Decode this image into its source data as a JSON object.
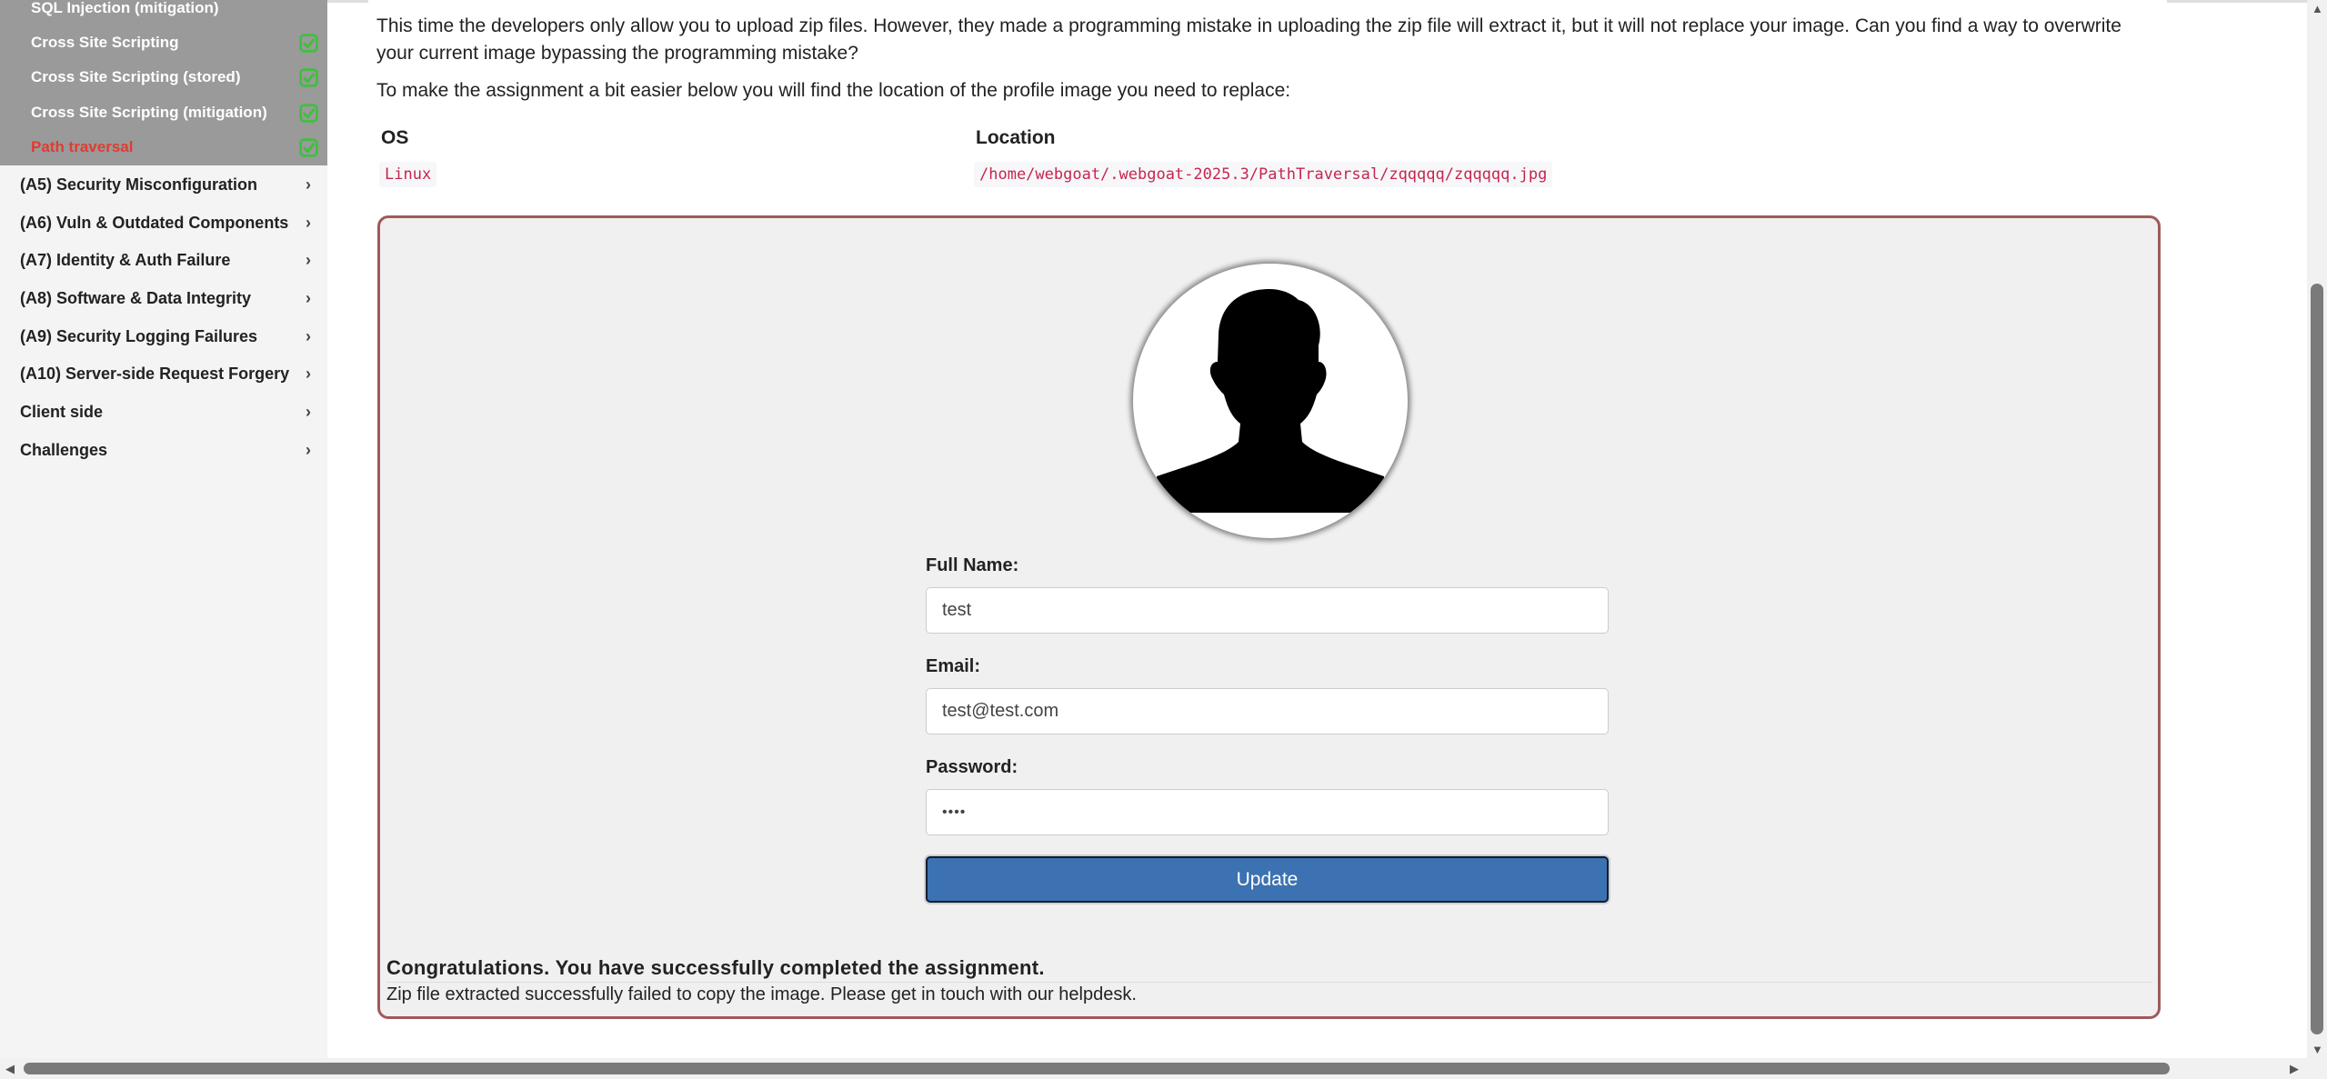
{
  "sidebar": {
    "subitems": [
      {
        "label": "SQL Injection (mitigation)",
        "done": true
      },
      {
        "label": "Cross Site Scripting",
        "done": true
      },
      {
        "label": "Cross Site Scripting (stored)",
        "done": true
      },
      {
        "label": "Cross Site Scripting (mitigation)",
        "done": true
      },
      {
        "label": "Path traversal",
        "done": true,
        "active": true
      }
    ],
    "categories": [
      "(A5) Security Misconfiguration",
      "(A6) Vuln & Outdated Components",
      "(A7) Identity & Auth Failure",
      "(A8) Software & Data Integrity",
      "(A9) Security Logging Failures",
      "(A10) Server-side Request Forgery",
      "Client side",
      "Challenges"
    ],
    "chevron": "›",
    "check_icon": "check-square-icon",
    "colors": {
      "check": "#3fbf3f",
      "active": "#e03c31",
      "submenu_bg": "#9a9a9a"
    }
  },
  "lesson": {
    "intro": "This time the developers only allow you to upload zip files. However, they made a programming mistake in uploading the zip file will extract it, but it will not replace your image. Can you find a way to overwrite your current image bypassing the programming mistake?",
    "intro2": "To make the assignment a bit easier below you will find the location of the profile image you need to replace:",
    "table": {
      "headers": [
        "OS",
        "Location"
      ],
      "row": [
        "Linux",
        "/home/webgoat/.webgoat-2025.3/PathTraversal/zqqqqq/zqqqqq.jpg"
      ]
    }
  },
  "form": {
    "avatar_icon": "user-silhouette-icon",
    "fullname_label": "Full Name:",
    "fullname_value": "test",
    "email_label": "Email:",
    "email_value": "test@test.com",
    "password_label": "Password:",
    "password_value": "••••",
    "update_label": "Update"
  },
  "result": {
    "title": "Congratulations. You have successfully completed the assignment.",
    "message": "Zip file extracted successfully failed to copy the image. Please get in touch with our helpdesk."
  },
  "colors": {
    "panel_border": "#a0595a",
    "button": "#3c72b1",
    "code": "#c7254e"
  }
}
